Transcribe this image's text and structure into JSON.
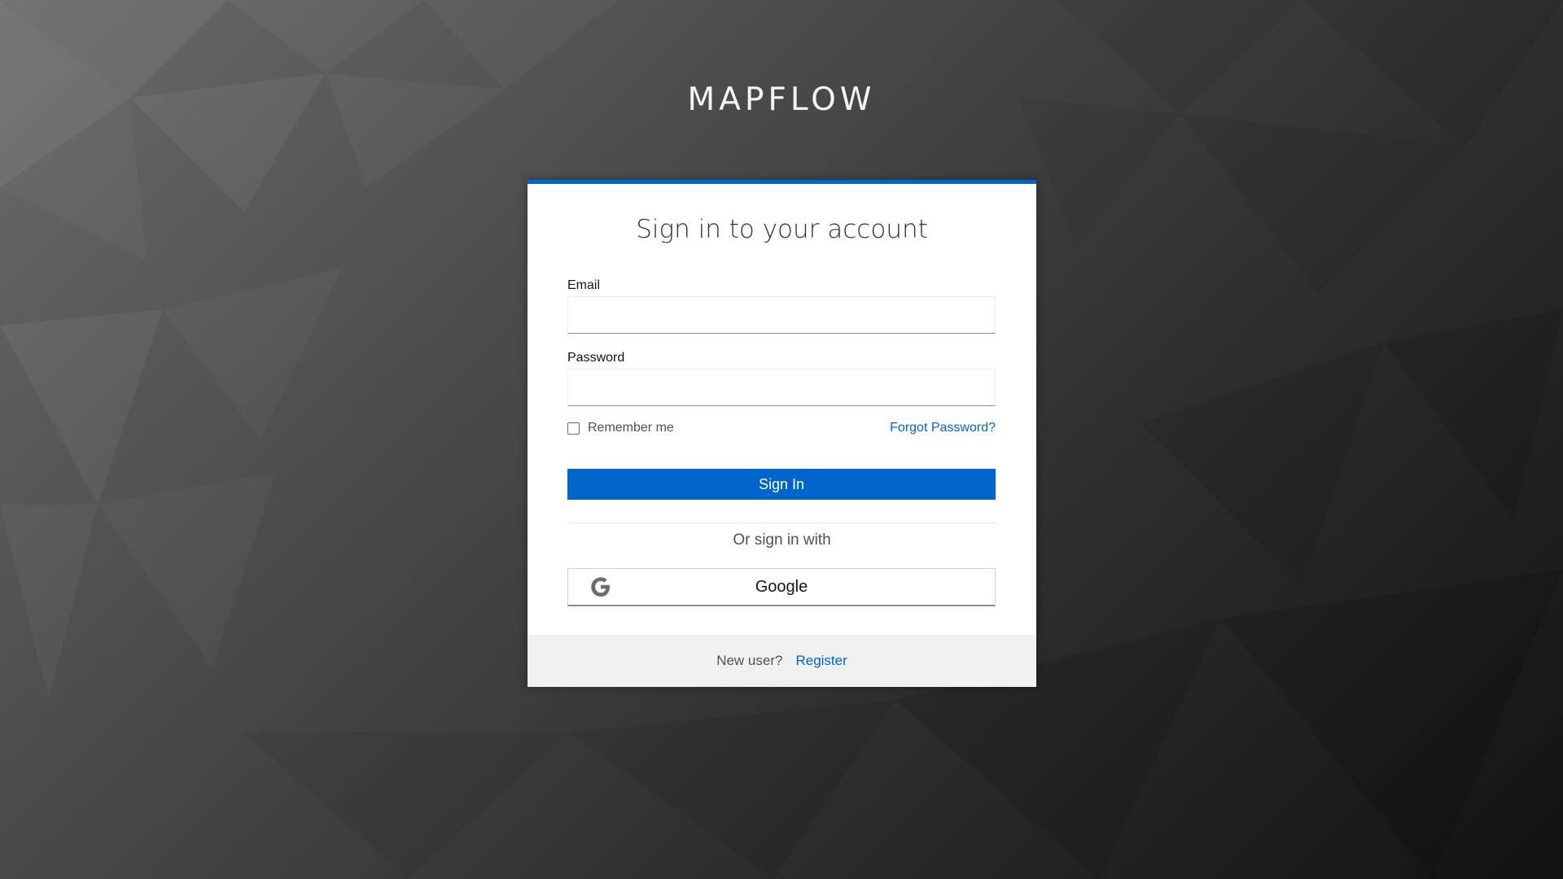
{
  "brand": "MAPFLOW",
  "login": {
    "title": "Sign in to your account",
    "email_label": "Email",
    "email_value": "",
    "password_label": "Password",
    "password_value": "",
    "remember_label": "Remember me",
    "remember_checked": false,
    "forgot_link": "Forgot Password?",
    "sign_in_button": "Sign In",
    "or_text": "Or sign in with",
    "google_button": "Google",
    "google_icon": "google-g-icon"
  },
  "footer": {
    "new_user_text": "New user?",
    "register_link": "Register"
  },
  "colors": {
    "accent": "#0066cc",
    "footer_bg": "#f0f0f0"
  }
}
